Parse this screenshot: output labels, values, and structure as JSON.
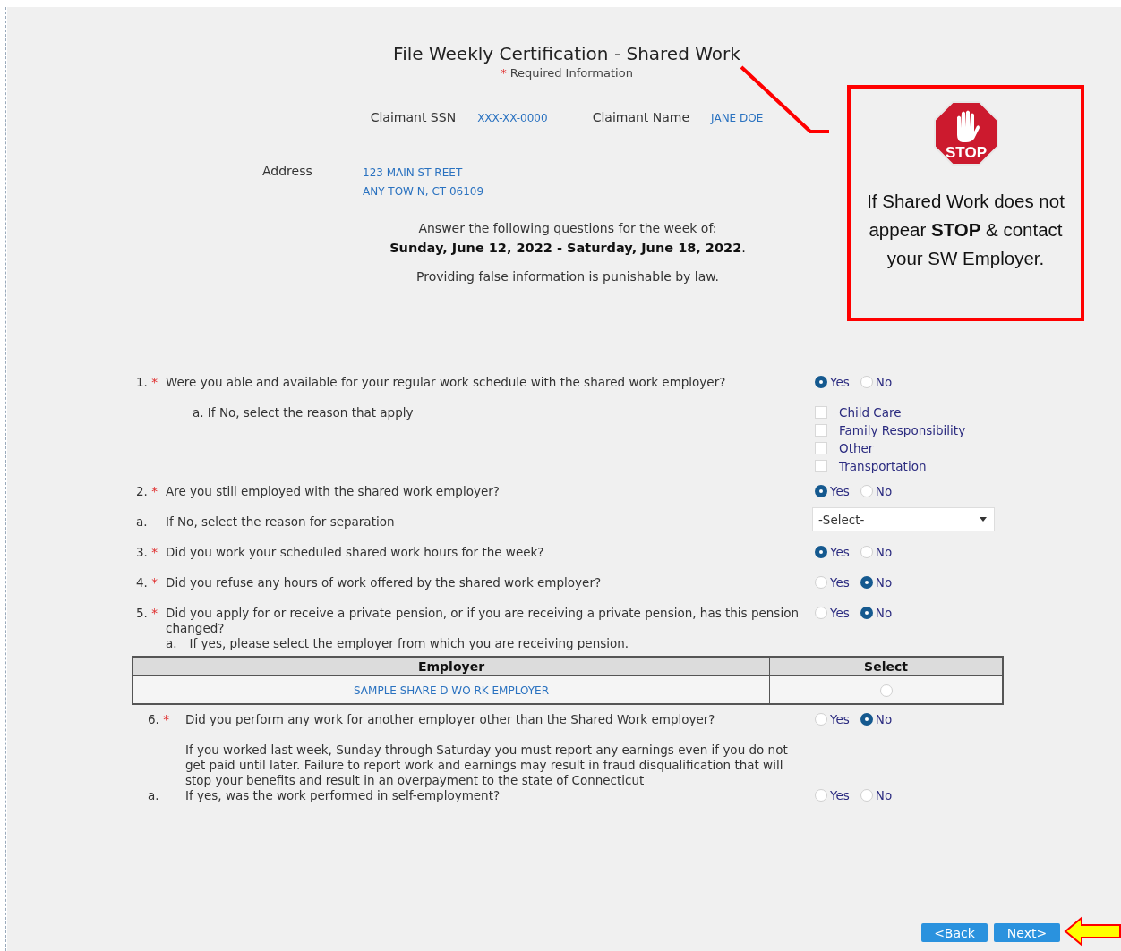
{
  "header": {
    "title": "File Weekly Certification - Shared Work",
    "required_mark": "*",
    "required_note": "Required Information"
  },
  "claimant": {
    "ssn_label": "Claimant SSN",
    "ssn": "XXX-XX-0000",
    "name_label": "Claimant Name",
    "name": "JANE DOE"
  },
  "address": {
    "label": "Address",
    "lines": [
      "123 MAIN ST REET",
      "ANY TOW N, CT  06109"
    ]
  },
  "week": {
    "prompt": "Answer the following questions for the week of:",
    "range": "**Sunday, June 12, 2022  -  Saturday, June 18, 2022**.",
    "warning": "Providing false information is punishable by law."
  },
  "callout": {
    "sign_label": "STOP",
    "text": "If Shared Work does not appear **STOP** & contact your SW Employer."
  },
  "questions": [
    {
      "kind": "radio",
      "number": "1.",
      "required_mark": "*",
      "text": "Were you able and available for your regular work schedule with the shared work employer?",
      "options": [
        {
          "label": "Yes",
          "selected": true
        },
        {
          "label": "No",
          "selected": false
        }
      ]
    },
    {
      "kind": "checkboxes",
      "text": "a. If No, select the reason that apply",
      "options": [
        {
          "label": "Child Care",
          "checked": false
        },
        {
          "label": "Family Responsibility",
          "checked": false
        },
        {
          "label": "Other",
          "checked": false
        },
        {
          "label": "Transportation",
          "checked": false
        }
      ]
    },
    {
      "kind": "radio",
      "number": "2.",
      "required_mark": "*",
      "text": "Are you still employed with the shared work employer?",
      "options": [
        {
          "label": "Yes",
          "selected": true
        },
        {
          "label": "No",
          "selected": false
        }
      ]
    },
    {
      "kind": "select",
      "number": "a.",
      "text": "If No, select the reason for separation",
      "value": "-Select-"
    },
    {
      "kind": "radio",
      "number": "3.",
      "required_mark": "*",
      "text": "Did you work your scheduled shared work hours for the week?",
      "options": [
        {
          "label": "Yes",
          "selected": true
        },
        {
          "label": "No",
          "selected": false
        }
      ]
    },
    {
      "kind": "radio",
      "number": "4.",
      "required_mark": "*",
      "text": "Did you refuse any hours of work offered by the shared work employer?",
      "options": [
        {
          "label": "Yes",
          "selected": false
        },
        {
          "label": "No",
          "selected": true
        }
      ]
    },
    {
      "kind": "radio",
      "number": "5.",
      "required_mark": "*",
      "text": "Did you apply for or receive a private pension, or if you are receiving a private pension, has this pension changed?",
      "options": [
        {
          "label": "Yes",
          "selected": false
        },
        {
          "label": "No",
          "selected": true
        }
      ]
    },
    {
      "kind": "sub",
      "number": "a.",
      "text": "If yes, please select the employer from which you are receiving pension."
    }
  ],
  "pension_table": {
    "columns": [
      "Employer",
      "Select"
    ],
    "rows": [
      {
        "employer": "SAMPLE SHARE D WO RK EMPLOYER",
        "selected": false
      }
    ]
  },
  "more_questions": [
    {
      "kind": "radio",
      "number": "6.",
      "required_mark": "*",
      "text": "Did you perform any work for another employer other than the Shared Work employer?",
      "note": "If you worked last week, Sunday through Saturday you must report any earnings even if you do not get paid until later. Failure to report work and earnings may result in fraud disqualification that will stop your benefits and result in an overpayment to the state of Connecticut",
      "options": [
        {
          "label": "Yes",
          "selected": false
        },
        {
          "label": "No",
          "selected": true
        }
      ]
    },
    {
      "kind": "radio",
      "number": "a.",
      "text": "If yes, was the work performed in self-employment?",
      "options": [
        {
          "label": "Yes",
          "selected": false
        },
        {
          "label": "No",
          "selected": false
        }
      ]
    }
  ],
  "buttons": [
    "<Back",
    "Next>"
  ]
}
